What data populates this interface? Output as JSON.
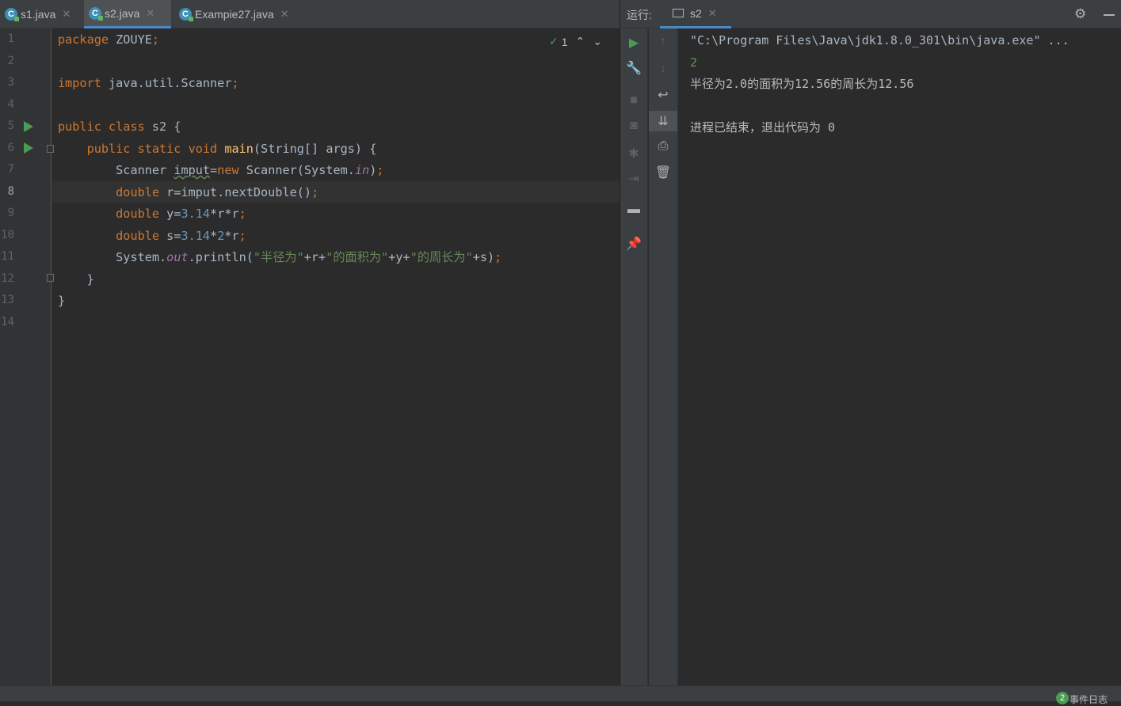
{
  "editor_tabs": [
    {
      "label": "s1.java",
      "active": false
    },
    {
      "label": "s2.java",
      "active": true
    },
    {
      "label": "Exampie27.java",
      "active": false
    }
  ],
  "inspection_count": "1",
  "line_numbers": [
    "1",
    "2",
    "3",
    "4",
    "5",
    "6",
    "7",
    "8",
    "9",
    "10",
    "11",
    "12",
    "13",
    "14"
  ],
  "current_line": "8",
  "code": {
    "l1_kw": "package",
    "l1_rest": " ZOUYE",
    "semi": ";",
    "l3_kw": "import",
    "l3_rest": " java.util.Scanner",
    "l5_kw": "public class",
    "l5_rest": " s2 {",
    "l6_kw": "public static void",
    "l6_fn": "main",
    "l6_rest": "(String[] args) {",
    "l7_a": "Scanner ",
    "l7_var": "imput",
    "l7_b": "=",
    "l7_kw": "new",
    "l7_c": " Scanner(System.",
    "l7_fld": "in",
    "l7_d": ")",
    "l8_kw": "double",
    "l8_rest": " r=imput.nextDouble()",
    "l9_kw": "double",
    "l9_a": " y=",
    "l9_num": "3.14",
    "l9_b": "*r*r",
    "l10_kw": "double",
    "l10_a": " s=",
    "l10_num": "3.14",
    "l10_b": "*",
    "l10_num2": "2",
    "l10_c": "*r",
    "l11_a": "System.",
    "l11_fld": "out",
    "l11_b": ".println(",
    "l11_s1": "\"半径为\"",
    "l11_c": "+r+",
    "l11_s2": "\"的面积为\"",
    "l11_d": "+y+",
    "l11_s3": "\"的周长为\"",
    "l11_e": "+s)",
    "l12": "}",
    "l13": "}"
  },
  "run_panel": {
    "label": "运行:",
    "tab": "s2"
  },
  "console": {
    "cmd": "\"C:\\Program Files\\Java\\jdk1.8.0_301\\bin\\java.exe\" ...",
    "input": "2",
    "output": "半径为2.0的面积为12.56的周长为12.56",
    "exit": "进程已结束，退出代码为 0"
  },
  "status": {
    "event_count": "2",
    "event_label": "事件日志"
  },
  "colors": {
    "keyword": "#cc7832",
    "number": "#6897bb",
    "string": "#6a8759",
    "field": "#9876aa",
    "method": "#ffc66d",
    "run_green": "#499c54",
    "input_green": "#629755"
  }
}
